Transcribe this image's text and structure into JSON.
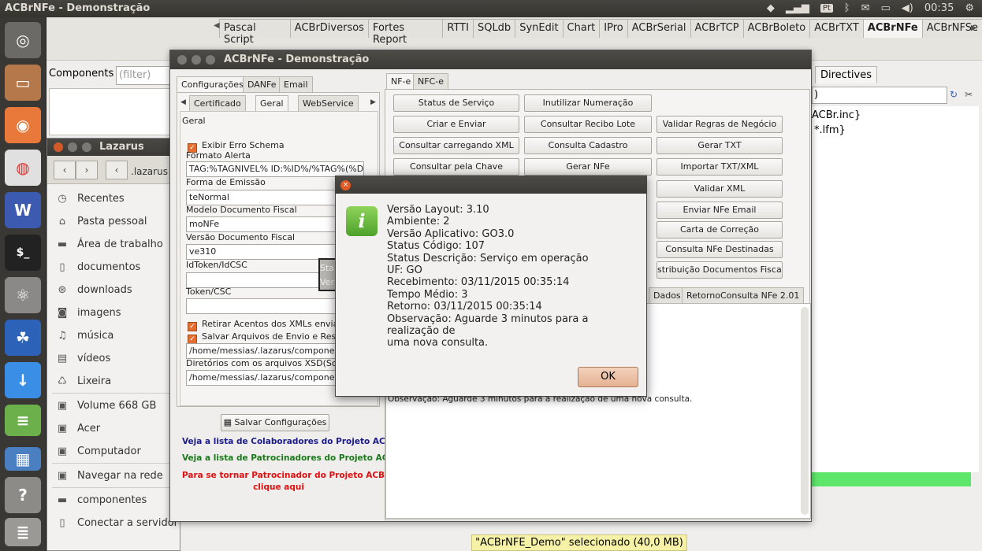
{
  "topbar": {
    "title": "ACBrNFe - Demonstração",
    "keyboard": "Pt",
    "clock": "00:35"
  },
  "ide": {
    "palette_tabs": [
      "Pascal Script",
      "ACBrDiversos",
      "Fortes Report",
      "RTTI",
      "SQLdb",
      "SynEdit",
      "Chart",
      "IPro",
      "ACBrSerial",
      "ACBrTCP",
      "ACBrBoleto",
      "ACBrTXT",
      "ACBrNFe",
      "ACBrNFSe"
    ],
    "active_tab": "ACBrNFe",
    "components_label": "Components",
    "filter_placeholder": "(filter)",
    "directives_tab": "Directives",
    "directives_field": ")",
    "directives_items": [
      "ACBr.inc}",
      "*.lfm}"
    ]
  },
  "nautilus": {
    "title": "Lazarus",
    "path": ".lazarus",
    "items": [
      "Recentes",
      "Pasta pessoal",
      "Área de trabalho",
      "documentos",
      "downloads",
      "imagens",
      "música",
      "vídeos",
      "Lixeira",
      "Volume 668 GB",
      "Acer",
      "Computador",
      "Navegar na rede",
      "componentes",
      "Conectar a servidor"
    ]
  },
  "app": {
    "title": "ACBrNFe - Demonstração",
    "left_tabs": [
      "Configurações",
      "DANFe",
      "Email"
    ],
    "sub_tabs": [
      "Certificado",
      "Geral",
      "WebService"
    ],
    "group": "Geral",
    "exibir_erro": "Exibir Erro Schema",
    "formato_alerta_label": "Formato Alerta",
    "formato_alerta": "TAG:%TAGNIVEL% ID:%ID%/%TAG%(%DESC",
    "forma_emissao_label": "Forma de Emissão",
    "forma_emissao": "teNormal",
    "modelo_label": "Modelo Documento Fiscal",
    "modelo": "moNFe",
    "versao_label": "Versão Documento Fiscal",
    "versao": "ve310",
    "idtoken_label": "IdToken/IdCSC",
    "token_label": "Token/CSC",
    "retirar_acentos": "Retirar Acentos dos XMLs enviad",
    "salvar_arquivos": "Salvar Arquivos de Envio e Resp",
    "path1": "/home/messias/.lazarus/component",
    "dir_xsd_label": "Diretórios com os arquivos XSD(Sche",
    "path2": "/home/messias/.lazarus/component",
    "save_btn": "Salvar Configurações",
    "link1": "Veja a lista de Colaboradores do Projeto ACB",
    "link2": "Veja a lista de Patrocinadores do Projeto ACB",
    "link3": "Para se tornar Patrocinador do Projeto ACBr,",
    "link3b": "clique aqui",
    "right_tabs": [
      "NF-e",
      "NFC-e"
    ],
    "buttons": {
      "status": "Status de Serviço",
      "inutilizar": "Inutilizar Numeração",
      "criar": "Criar e Enviar",
      "consultar_recibo": "Consultar Recibo Lote",
      "validar_regras": "Validar Regras de Negócio",
      "consultar_xml": "Consultar carregando XML",
      "consultar_cadastro": "Consulta Cadastro",
      "gerar_txt": "Gerar TXT",
      "consultar_chave": "Consultar pela Chave",
      "gerar_nfe": "Gerar NFe",
      "importar": "Importar TXT/XML",
      "validar_xml": "Validar XML",
      "enviar_email": "Enviar NFe Email",
      "carta": "Carta de Correção",
      "destinadas": "Consulta NFe Destinadas",
      "distribuicao": "stribuição Documentos Fiscai"
    },
    "result_tabs": [
      "Dados",
      "RetornoConsulta NFe 2.01"
    ],
    "status_stub": "Sta",
    "versao_stub": "Vers",
    "result_text": "Observação: Aguarde 3 minutos para a realização de uma nova consulta."
  },
  "dialog": {
    "lines": [
      "Versão Layout: 3.10",
      "Ambiente: 2",
      "Versão Aplicativo: GO3.0",
      "Status Código: 107",
      "Status Descrição: Serviço em operação",
      "UF: GO",
      "Recebimento: 03/11/2015 00:35:14",
      "Tempo Médio: 3",
      "Retorno: 03/11/2015 00:35:14",
      "Observação: Aguarde 3 minutos para a realização de",
      "uma nova consulta."
    ],
    "ok": "OK"
  },
  "status_pill": "\"ACBrNFE_Demo\" selecionado (40,0 MB)"
}
